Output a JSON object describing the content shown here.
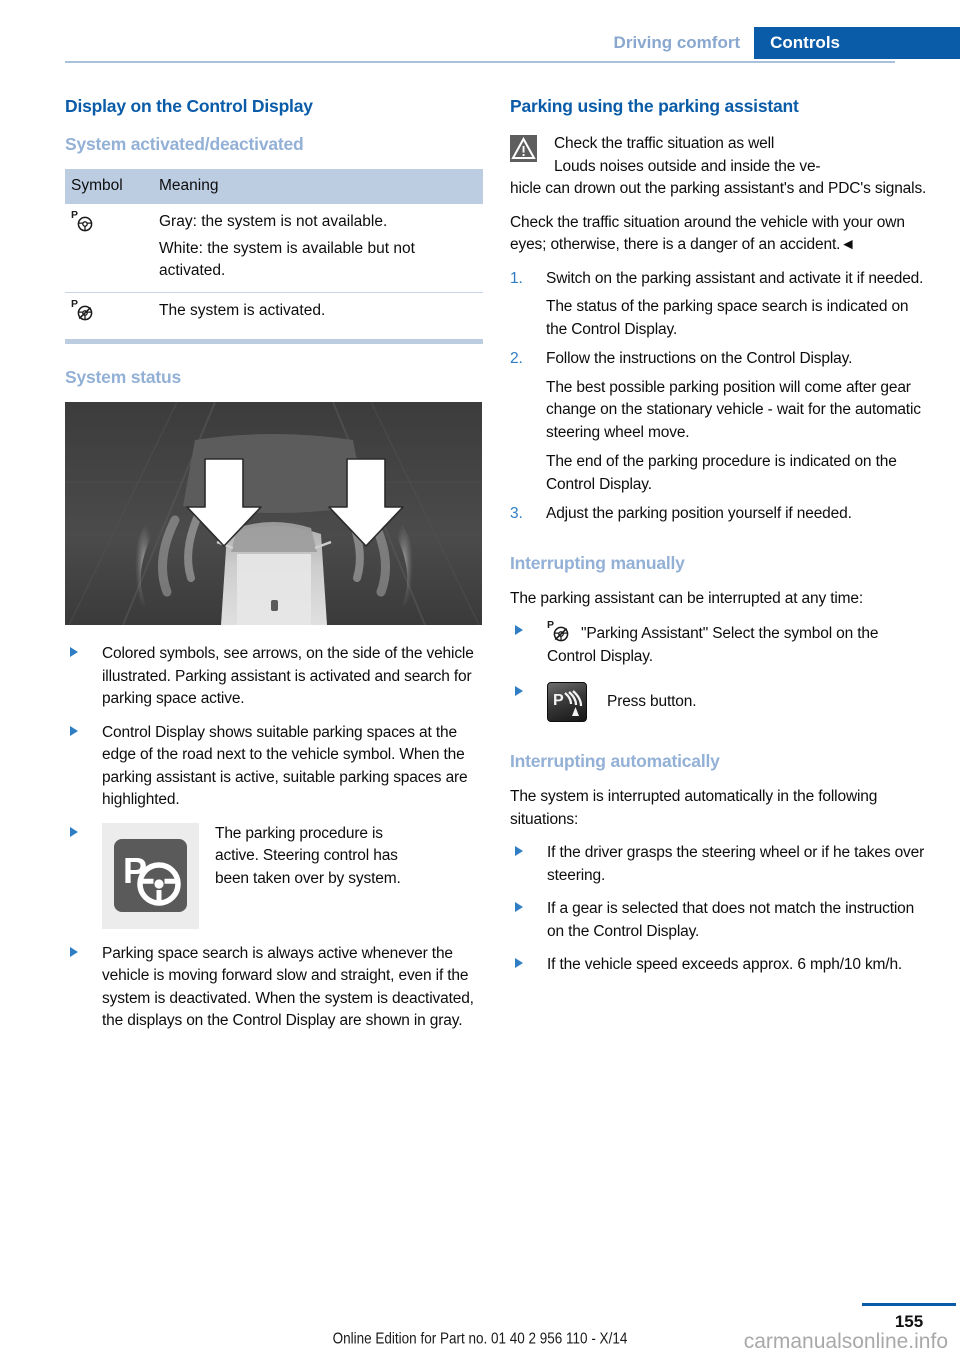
{
  "header": {
    "breadcrumb_inactive": "Driving comfort",
    "breadcrumb_active": "Controls"
  },
  "left": {
    "section_title": "Display on the Control Display",
    "subsection_1": "System activated/deactivated",
    "table": {
      "columns": [
        "Symbol",
        "Meaning"
      ],
      "rows": [
        {
          "symbol": "parking-assistant-inactive-icon",
          "lines": [
            "Gray: the system is not available.",
            "White: the system is available but not activated."
          ]
        },
        {
          "symbol": "parking-assistant-active-icon",
          "lines": [
            "The system is activated."
          ]
        }
      ]
    },
    "subsection_2": "System status",
    "figure_caption": "top-down-vehicle-parking-search-illustration",
    "bullets": [
      "Colored symbols, see arrows, on the side of the vehicle illustrated. Parking assistant is activated and search for parking space active.",
      "Control Display shows suitable parking spaces at the edge of the road next to the vehicle symbol. When the parking assistant is active, suitable parking spaces are highlighted.",
      "The parking procedure is active. Steering control has been taken over by system.",
      "Parking space search is always active whenever the vehicle is moving forward slow and straight, even if the system is deactivated. When the system is deactivated, the displays on the Control Display are shown in gray."
    ]
  },
  "right": {
    "section_title": "Parking using the parking assistant",
    "warning": {
      "icon": "warning-triangle-icon",
      "heading": "Check the traffic situation as well",
      "line1": "Louds noises outside and inside the ve-",
      "rest": "hicle can drown out the parking assistant's and PDC's signals.",
      "paragraph": "Check the traffic situation around the vehicle with your own eyes; otherwise, there is a danger of an accident.◄"
    },
    "steps": [
      {
        "number": "1.",
        "text": "Switch on the parking assistant and activate it if needed.",
        "note": "The status of the parking space search is indicated on the Control Display."
      },
      {
        "number": "2.",
        "text": "Follow the instructions on the Control Display.",
        "note": "The best possible parking position will come after gear change on the stationary vehicle - wait for the automatic steering wheel move.",
        "note2": "The end of the parking procedure is indicated on the Control Display."
      },
      {
        "number": "3.",
        "text": "Adjust the parking position yourself if needed.",
        "note": ""
      }
    ],
    "subsection_manual": "Interrupting manually",
    "manual_intro": "The parking assistant can be interrupted at any time:",
    "manual_bullets": [
      "\"Parking Assistant\" Select the symbol on the Control Display.",
      "Press button."
    ],
    "subsection_auto": "Interrupting automatically",
    "auto_intro": "The system is interrupted automatically in the following situations:",
    "auto_bullets": [
      "If the driver grasps the steering wheel or if he takes over steering.",
      "If a gear is selected that does not match the instruction on the Control Display.",
      "If the vehicle speed exceeds approx. 6 mph/10 km/h."
    ]
  },
  "footer": {
    "page_number": "155",
    "edition": "Online Edition for Part no. 01 40 2 956 110 - X/14",
    "watermark": "carmanualsonline.info"
  },
  "colors": {
    "accent_blue": "#0a5ca8",
    "light_blue": "#93b0d6",
    "table_header": "#bccde2",
    "bullet_blue": "#2f7ec4"
  }
}
